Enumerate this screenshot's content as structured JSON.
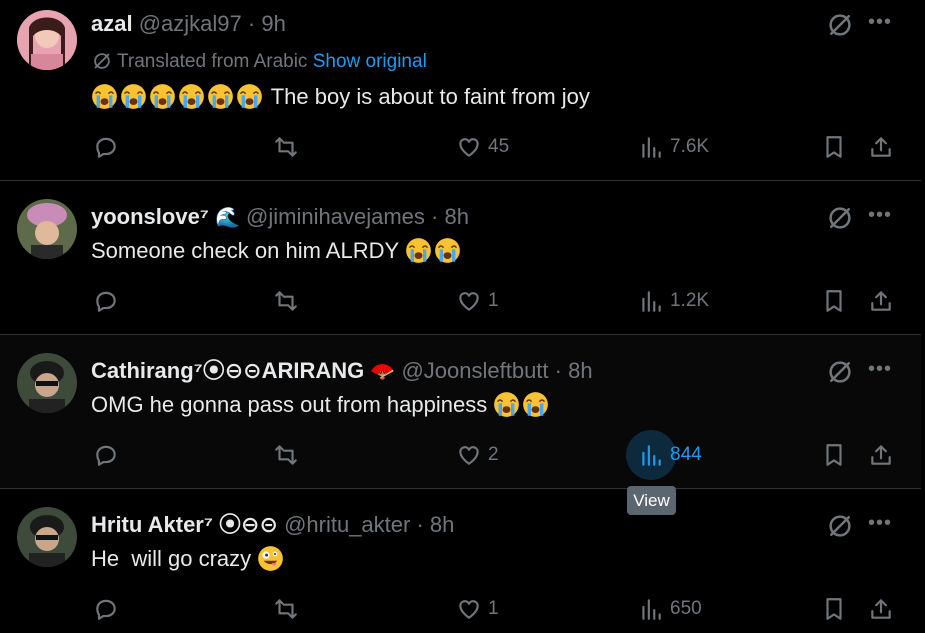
{
  "tweets": [
    {
      "name": "azal",
      "handle": "@azjkal97",
      "time": "9h",
      "translated_label": "Translated from Arabic",
      "show_original": "Show original",
      "text": "The boy is about to faint from joy",
      "emoji_count": 6,
      "replies": "",
      "retweets": "",
      "likes": "45",
      "views": "7.6K"
    },
    {
      "name": "yoonslove⁷",
      "handle": "@jiminihavejames",
      "time": "8h",
      "text": "Someone check on him ALRDY",
      "emoji_count": 2,
      "replies": "",
      "retweets": "",
      "likes": "1",
      "views": "1.2K"
    },
    {
      "name": "Cathirang⁷⦿⊖⊝ARIRANG",
      "handle": "@Joonsleftbutt",
      "time": "8h",
      "text": "OMG he gonna pass out from happiness",
      "emoji_count": 2,
      "replies": "",
      "retweets": "",
      "likes": "2",
      "views": "844"
    },
    {
      "name": "Hritu Akter⁷ ⦿⊖⊝",
      "handle": "@hritu_akter",
      "time": "8h",
      "text": "He  will go crazy",
      "emoji_count": 1,
      "replies": "",
      "retweets": "",
      "likes": "1",
      "views": "650"
    }
  ],
  "tooltip": "View",
  "colors": {
    "background": "#000000",
    "accent": "#1d9bf0",
    "muted": "#71767b",
    "text": "#e7e9ea"
  },
  "icons": [
    "grok-icon",
    "more-icon",
    "reply-icon",
    "retweet-icon",
    "like-icon",
    "views-icon",
    "bookmark-icon",
    "share-icon",
    "translate-icon"
  ]
}
